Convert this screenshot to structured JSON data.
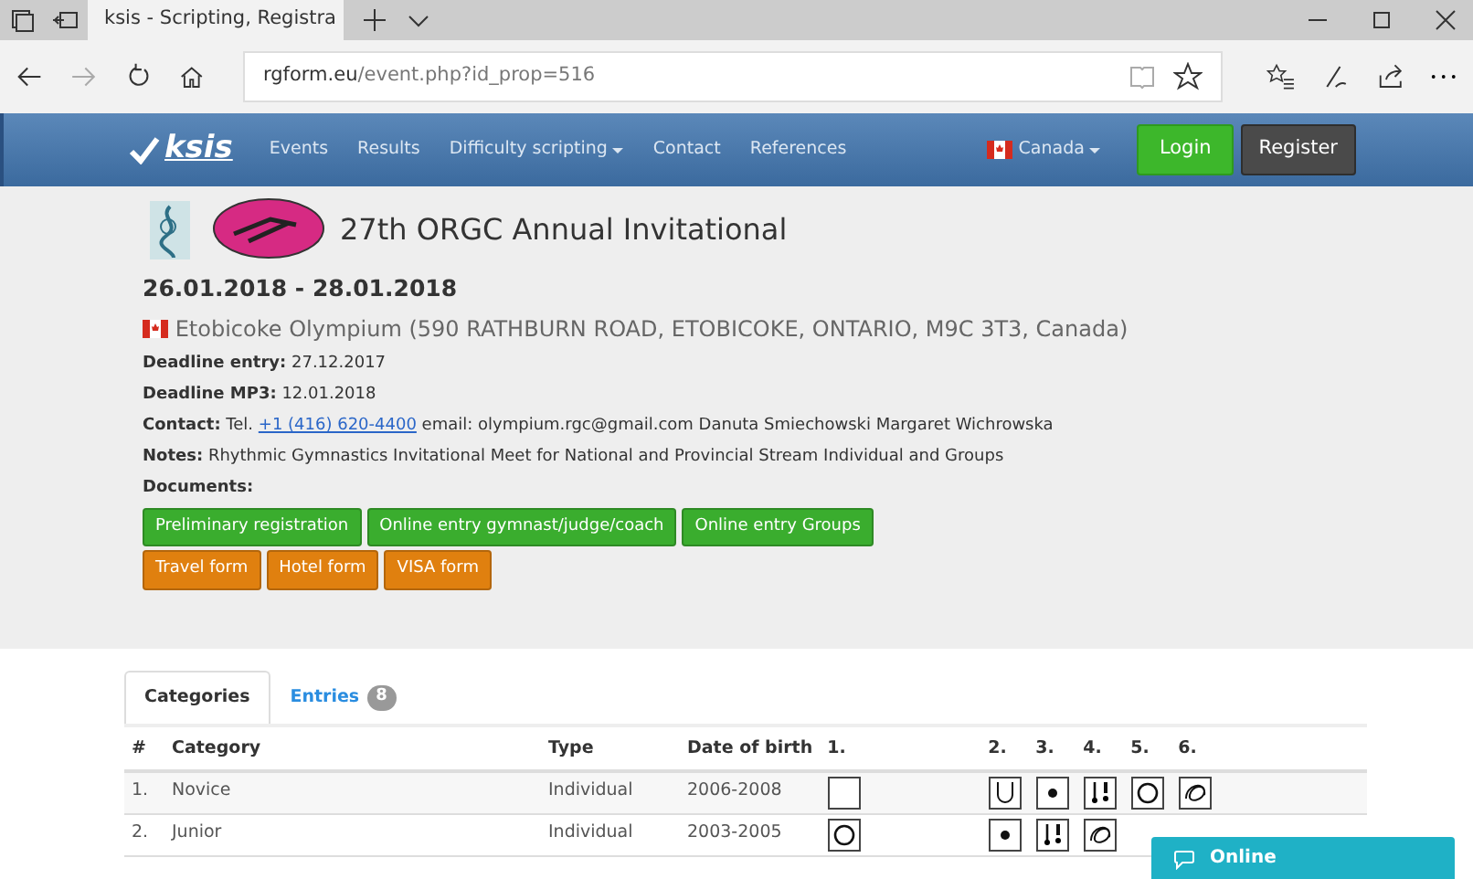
{
  "browser": {
    "tab_title": "ksis - Scripting, Registra",
    "url_host": "rgform.eu",
    "url_path": "/event.php?id_prop=516"
  },
  "navbar": {
    "brand": "ksis",
    "items": [
      {
        "label": "Events",
        "dropdown": false
      },
      {
        "label": "Results",
        "dropdown": false
      },
      {
        "label": "Difficulty scripting",
        "dropdown": true
      },
      {
        "label": "Contact",
        "dropdown": false
      },
      {
        "label": "References",
        "dropdown": false
      }
    ],
    "country": "Canada",
    "login": "Login",
    "register": "Register"
  },
  "event": {
    "title": "27th ORGC Annual Invitational",
    "dates": "26.01.2018 - 28.01.2018",
    "venue": "Etobicoke Olympium (590 RATHBURN ROAD, ETOBICOKE, ONTARIO, M9C 3T3, Canada)",
    "details": [
      {
        "kind": "text",
        "label": "Deadline entry:",
        "value": "27.12.2017"
      },
      {
        "kind": "text",
        "label": "Deadline MP3:",
        "value": "12.01.2018"
      },
      {
        "kind": "contact",
        "label": "Contact:",
        "prefix": "Tel.",
        "link": "+1 (416) 620-4400",
        "value": "email: olympium.rgc@gmail.com Danuta Smiechowski Margaret Wichrowska"
      },
      {
        "kind": "text",
        "label": "Notes:",
        "value": "Rhythmic Gymnastics Invitational Meet for National and Provincial Stream Individual and Groups"
      }
    ],
    "documents_label": "Documents:",
    "documents": [
      [
        {
          "label": "Preliminary registration",
          "color": "#3aad2e"
        },
        {
          "label": "Online entry gymnast/judge/coach",
          "color": "#3aad2e"
        },
        {
          "label": "Online entry Groups",
          "color": "#3aad2e"
        }
      ],
      [
        {
          "label": "Travel form",
          "color": "#e0800f"
        },
        {
          "label": "Hotel form",
          "color": "#e0800f"
        },
        {
          "label": "VISA form",
          "color": "#e0800f"
        }
      ]
    ]
  },
  "tabs": [
    {
      "label": "Categories",
      "selected": true
    },
    {
      "label": "Entries",
      "selected": false,
      "badge": "8"
    }
  ],
  "table": {
    "columns": [
      "#",
      "Category",
      "Type",
      "Date of birth",
      "1.",
      "2.",
      "3.",
      "4.",
      "5.",
      "6."
    ],
    "rows": [
      {
        "num": "1.",
        "category": "Novice",
        "type": "Individual",
        "dob": "2006-2008",
        "apparatus": [
          {
            "kind": "freehand"
          },
          {
            "kind": "rope"
          },
          {
            "kind": "ball"
          },
          {
            "kind": "clubs"
          },
          {
            "kind": "hoop"
          },
          {
            "kind": "ribbon"
          }
        ]
      },
      {
        "num": "2.",
        "category": "Junior",
        "type": "Individual",
        "dob": "2003-2005",
        "apparatus": [
          {
            "kind": "hoop"
          },
          {
            "kind": "ball"
          },
          {
            "kind": "clubs"
          },
          {
            "kind": "ribbon"
          }
        ]
      }
    ]
  },
  "chat": {
    "label": "Online"
  }
}
